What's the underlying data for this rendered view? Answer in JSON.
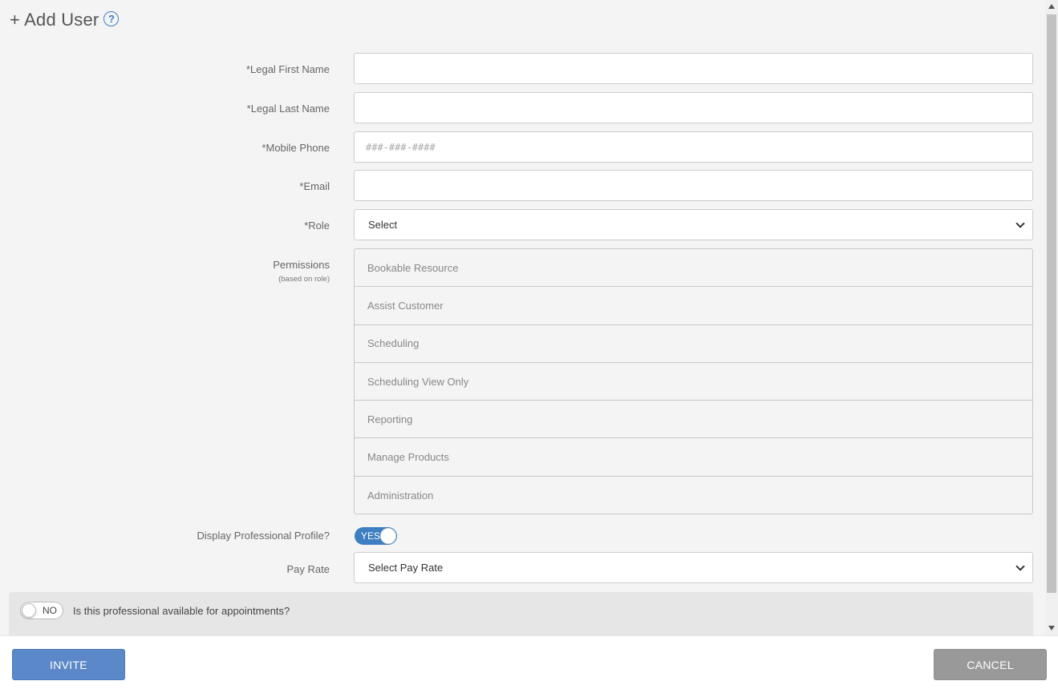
{
  "header": {
    "title": "+ Add User",
    "help_icon": "question-circle-icon"
  },
  "form": {
    "first_name": {
      "label": "*Legal First Name",
      "value": ""
    },
    "last_name": {
      "label": "*Legal Last Name",
      "value": ""
    },
    "mobile_phone": {
      "label": "*Mobile Phone",
      "placeholder": "###-###-####",
      "value": ""
    },
    "email": {
      "label": "*Email",
      "value": ""
    },
    "role": {
      "label": "*Role",
      "selected": "Select"
    },
    "permissions": {
      "label": "Permissions",
      "sublabel": "(based on role)",
      "items": [
        "Bookable Resource",
        "Assist Customer",
        "Scheduling",
        "Scheduling View Only",
        "Reporting",
        "Manage Products",
        "Administration"
      ]
    },
    "display_profile": {
      "label": "Display Professional Profile?",
      "toggle_text": "YES",
      "on": true
    },
    "pay_rate": {
      "label": "Pay Rate",
      "selected": "Select Pay Rate"
    },
    "availability": {
      "toggle_text": "NO",
      "on": false,
      "question": "Is this professional available for appointments?"
    }
  },
  "footer": {
    "invite_label": "INVITE",
    "cancel_label": "CANCEL"
  },
  "colors": {
    "accent": "#3d7fc1",
    "invite_button": "#5b88c8",
    "cancel_button": "#999999"
  }
}
